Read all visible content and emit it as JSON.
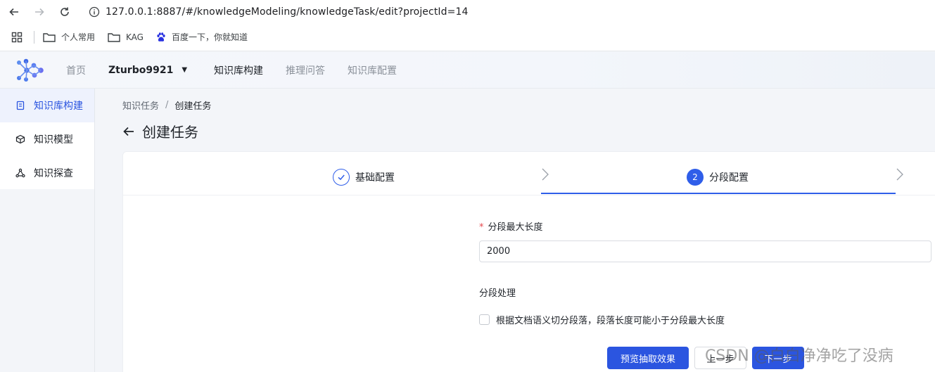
{
  "browser": {
    "url": "127.0.0.1:8887/#/knowledgeModeling/knowledgeTask/edit?projectId=14",
    "bookmarks": [
      "个人常用",
      "KAG",
      "百度一下，你就知道"
    ]
  },
  "header": {
    "nav_home": "首页",
    "project_name": "Zturbo9921",
    "nav_items": [
      "知识库构建",
      "推理问答",
      "知识库配置"
    ],
    "active_nav": "知识库构建"
  },
  "sidebar": {
    "items": [
      {
        "label": "知识库构建",
        "icon": "document-icon",
        "active": true
      },
      {
        "label": "知识模型",
        "icon": "cube-icon",
        "active": false
      },
      {
        "label": "知识探查",
        "icon": "graph-nodes-icon",
        "active": false
      }
    ]
  },
  "breadcrumb": {
    "parent": "知识任务",
    "separator": "/",
    "current": "创建任务"
  },
  "page_title": "创建任务",
  "steps": [
    {
      "label": "基础配置",
      "status": "done"
    },
    {
      "label": "分段配置",
      "status": "active",
      "number": "2"
    }
  ],
  "form": {
    "max_length_label": "分段最大长度",
    "required_mark": "*",
    "max_length_value": "2000",
    "segment_section_label": "分段处理",
    "checkbox_label": "根据文档语义切分段落，段落长度可能小于分段最大长度",
    "checkbox_checked": false
  },
  "buttons": {
    "preview": "预览抽取效果",
    "prev": "上一步",
    "next": "下一步"
  },
  "watermark": "CSDN @白白净净吃了没病",
  "colors": {
    "primary": "#2b55e0",
    "required": "#e5484d",
    "sidebar_active_bg": "#eef2fd"
  }
}
